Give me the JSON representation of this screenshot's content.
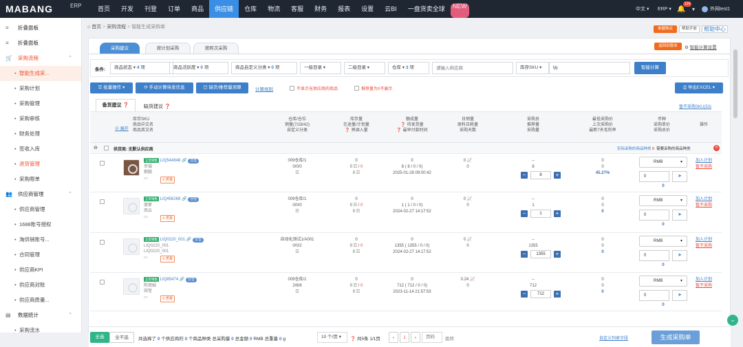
{
  "topbar": {
    "logo": "MABANG",
    "logo_suffix": "ERP",
    "nav": [
      "首页",
      "开发",
      "刊登",
      "订单",
      "商品",
      "供应链",
      "仓库",
      "物流",
      "客服",
      "财务",
      "报表",
      "设置",
      "云BI",
      "一盘货卖全球"
    ],
    "nav_active": "供应链",
    "new_badge": "NEW",
    "lang": "中文",
    "erp": "ERP",
    "notif_count": "124",
    "user": "外网test1"
  },
  "sidebar": {
    "items": [
      {
        "label": "折叠面板",
        "icon": "menu-icon"
      },
      {
        "label": "折叠面板",
        "icon": "menu-icon"
      },
      {
        "label": "采购流程",
        "icon": "cart-icon",
        "group": true,
        "red": true
      },
      {
        "label": "智能生成采...",
        "sub": true,
        "active": true
      },
      {
        "label": "采购计划",
        "sub": true
      },
      {
        "label": "采购管理",
        "sub": true
      },
      {
        "label": "采购审核",
        "sub": true
      },
      {
        "label": "财务处理",
        "sub": true
      },
      {
        "label": "签收入库",
        "sub": true
      },
      {
        "label": "退货管理",
        "sub": true,
        "red": true
      },
      {
        "label": "采购限单",
        "sub": true
      },
      {
        "label": "供应商管理",
        "icon": "group-icon",
        "group": true
      },
      {
        "label": "供应商管理",
        "sub": true
      },
      {
        "label": "1688账号授权",
        "sub": true
      },
      {
        "label": "淘供销账号...",
        "sub": true
      },
      {
        "label": "合同管理",
        "sub": true
      },
      {
        "label": "供应商KPI",
        "sub": true
      },
      {
        "label": "供应商对账",
        "sub": true
      },
      {
        "label": "供应商质量...",
        "sub": true
      },
      {
        "label": "数据统计",
        "icon": "chart-icon",
        "group": true
      },
      {
        "label": "采购流水",
        "sub": true
      }
    ]
  },
  "header": {
    "breadcrumb": [
      "首页",
      "采购流程",
      "智能生成采购单"
    ],
    "top_right": [
      "单据购买",
      "帮助手册",
      "帮助中心"
    ],
    "return_old": "返回旧版本",
    "smart_setting": "智能计算设置"
  },
  "tabs": [
    "采购建议",
    "按计划采购",
    "按照次采购"
  ],
  "filters": {
    "label": "条件:",
    "f1": {
      "name": "商品状态",
      "val": "4",
      "unit": "项"
    },
    "f2": {
      "name": "商品活跃度",
      "val": "0",
      "unit": "项"
    },
    "f3": {
      "name": "商品自定义分类",
      "val": "0",
      "unit": "项"
    },
    "f4": "一级目录",
    "f5": "二级目录",
    "f6": {
      "name": "仓库",
      "val": "3",
      "unit": "项"
    },
    "supplier_placeholder": "请输入供应商",
    "sku_select": "库存SKU",
    "sku_value": "ljq",
    "calc": "智能计算"
  },
  "toolbar": {
    "batch": "批量操作",
    "manual": "手动计算待发信息",
    "shortage": "缺货/推荐量测算",
    "rule": "计算规则",
    "opt1": "不显示无供应商的商品",
    "opt2": "推荐量为0不展示",
    "export": "导出EXCEL"
  },
  "subtabs": {
    "a": "备货建议",
    "b": "缺货建议",
    "pause_link": "暂不采购SKU(53)"
  },
  "thead": {
    "expand": "展开",
    "c1": [
      "库存SKU",
      "商品中文名",
      "商品英文名"
    ],
    "c2": [
      "仓库/仓位",
      "销量(7/28/42)",
      "自定义分类"
    ],
    "c3": [
      "库存量",
      "在途量/计划量",
      "预调入量"
    ],
    "c4": [
      "额成量",
      "待发货量",
      "最早付款时间"
    ],
    "c5": [
      "日销量",
      "原料日耗量",
      "采购天数"
    ],
    "c6": [
      "采购员",
      "推荐量",
      "采购量"
    ],
    "c7": [
      "最低采购价",
      "上次采购价",
      "最新7天毛利率"
    ],
    "c8": [
      "币种",
      "采购单价",
      "采购总价"
    ],
    "c9": [
      "操作"
    ]
  },
  "group_row": {
    "label": "供货商: 无默认供应商",
    "stat1": "实际采购的商品种类",
    "stat1_val": "0",
    "stat2": "需要采购的商品种类",
    "stat2_val": "8"
  },
  "rows": [
    {
      "tag": "正常销售",
      "sku": "LIQ544948",
      "fen": "分仓",
      "cn": "幸福",
      "en": "鹅腿",
      "wh": "009仓库/1",
      "sales": "0/0/0",
      "stock": "0",
      "transit": "0",
      "plan": "0",
      "pre": "0",
      "amt": "0",
      "pend": "8 ( 8 / 0 / 0)",
      "time": "2025-01-28 09:00:42",
      "day": "0",
      "raw": "0",
      "buyer": "--",
      "rec": "8",
      "qty": "8",
      "min": "0",
      "last": "0",
      "margin": "45.27%",
      "cur": "RMB",
      "price": "0",
      "total": "0",
      "act1": "加入计划",
      "act2": "暂不采购",
      "has_photo": true
    },
    {
      "tag": "正常销售",
      "sku": "LIQ456269",
      "fen": "分仓",
      "cn": "菠萝",
      "en": "南云",
      "wh": "009仓库/1",
      "sales": "0/0/0",
      "stock": "0",
      "transit": "0",
      "plan": "0",
      "pre": "0",
      "amt": "0",
      "pend": "1 ( 1 / 0 / 0)",
      "time": "2024-02-27 14:17:52",
      "day": "0",
      "raw": "0",
      "buyer": "--",
      "rec": "1",
      "qty": "1",
      "min": "0",
      "last": "0",
      "margin": "0",
      "cur": "RMB",
      "price": "0",
      "total": "0",
      "act1": "加入计划",
      "act2": "暂不采购"
    },
    {
      "tag": "正常销售",
      "sku": "LIQ0220_001",
      "fen": "分仓",
      "cn": "LIQ0220_001",
      "en": "LIQ0220_001",
      "wh": "自动化测试1/A001",
      "sales": "0/0/2",
      "stock": "0",
      "transit": "0",
      "plan": "0",
      "pre": "0",
      "amt": "0",
      "pend": "1355 ( 1355 / 0 / 0)",
      "time": "2024-02-27 14:17:52",
      "day": "0",
      "raw": "0",
      "buyer": "--",
      "rec": "1355",
      "qty": "1355",
      "min": "0",
      "last": "0",
      "margin": "0",
      "cur": "RMB",
      "price": "0",
      "total": "0",
      "act1": "加入计划",
      "act2": "暂不采购"
    },
    {
      "tag": "正常销售",
      "sku": "LIQ85474",
      "fen": "分仓",
      "cn": "陈丽娟",
      "en": "田莹",
      "wh": "009仓库/1",
      "sales": "2/6/6",
      "stock": "0",
      "transit": "0",
      "plan": "0",
      "pre": "0",
      "amt": "0",
      "pend": "712 ( 712 / 0 / 0)",
      "time": "2023-11-14 21:57:53",
      "day": "0.24",
      "raw": "0",
      "buyer": "--",
      "rec": "712",
      "qty": "712",
      "min": "0",
      "last": "0",
      "margin": "0",
      "cur": "RMB",
      "price": "0",
      "total": "0",
      "act1": "加入计划",
      "act2": "暂不采购"
    }
  ],
  "footer": {
    "all": "全选",
    "none": "全不选",
    "sel": "共选择了",
    "sel_val": "0",
    "sup": "个供应商的",
    "sup_val": "0",
    "kinds": "个商品种类",
    "qty_lbl": "总采购量",
    "qty_val": "0",
    "amt_lbl": "总金额",
    "amt_val": "0",
    "cur": "RMB",
    "w_lbl": "总重量",
    "w_val": "0",
    "w_unit": "g",
    "page_size": "10 个/页",
    "total": "共5条 1/1页",
    "page": "1",
    "jump_ph": "页码",
    "jump": "跳转",
    "custom": "自定义列表字段",
    "generate": "生成采购单"
  }
}
